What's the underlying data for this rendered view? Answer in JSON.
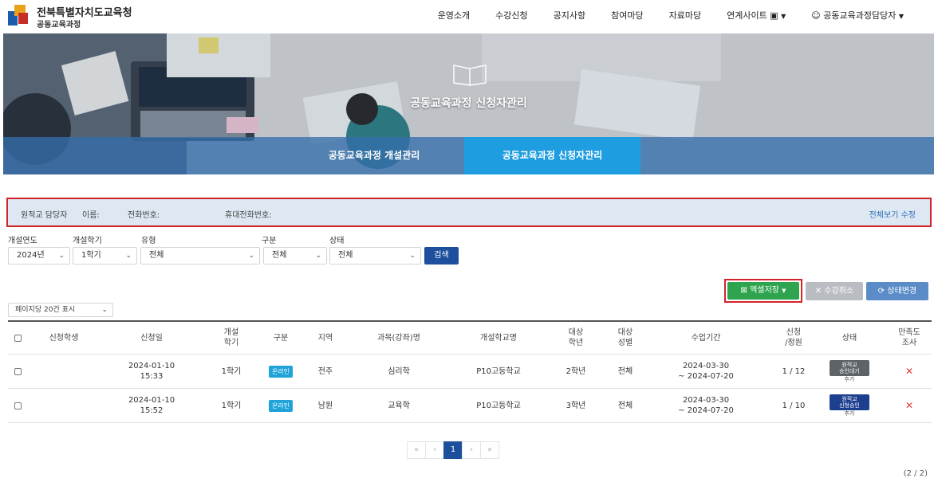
{
  "header": {
    "org_title": "전북특별자치도교육청",
    "org_subtitle": "공동교육과정",
    "nav": [
      "운영소개",
      "수강신청",
      "공지사항",
      "참여마당",
      "자료마당",
      "연계사이트"
    ],
    "user_label": "공동교육과정담당자"
  },
  "hero": {
    "title": "공동교육과정 신청자관리",
    "tabs": [
      "공동교육과정 개설관리",
      "공동교육과정 신청자관리"
    ]
  },
  "info_bar": {
    "school_manager_label": "원적교 담당자",
    "name_label": "이름:",
    "phone_label": "전화번호:",
    "mobile_label": "휴대전화번호:",
    "edit_link": "전체보기 수정"
  },
  "filters": {
    "year": {
      "label": "개설연도",
      "value": "2024년"
    },
    "semester": {
      "label": "개설학기",
      "value": "1학기"
    },
    "type": {
      "label": "유형",
      "value": "전체"
    },
    "category": {
      "label": "구분",
      "value": "전체"
    },
    "status": {
      "label": "상태",
      "value": "전체"
    },
    "search_label": "검색"
  },
  "actions": {
    "excel_label": "엑셀저장",
    "cancel_label": "수강취소",
    "status_change_label": "상태변경"
  },
  "page_size": "페이지당 20건 표시",
  "table": {
    "headers": {
      "student": "신청학생",
      "apply_date": "신청일",
      "semester": "개설\n학기",
      "category": "구분",
      "region": "지역",
      "subject": "과목(강좌)명",
      "school": "개설학교명",
      "target_grade": "대상\n학년",
      "target_gender": "대상\n성별",
      "period": "수업기간",
      "applicants": "신청\n/정원",
      "status": "상태",
      "survey": "만족도\n조사"
    },
    "rows": [
      {
        "student": "",
        "apply_date": "2024-01-10",
        "apply_time": "15:33",
        "semester": "1학기",
        "category": "온라인",
        "region": "전주",
        "subject": "심리학",
        "school": "P10고등학교",
        "target_grade": "2학년",
        "target_gender": "전체",
        "period_start": "2024-03-30",
        "period_end": "~ 2024-07-20",
        "applicants": "1 / 12",
        "status_line1": "원적교",
        "status_line2": "승인대기",
        "status_sub": "추가",
        "survey": "✕"
      },
      {
        "student": "",
        "apply_date": "2024-01-10",
        "apply_time": "15:52",
        "semester": "1학기",
        "category": "온라인",
        "region": "남원",
        "subject": "교육학",
        "school": "P10고등학교",
        "target_grade": "3학년",
        "target_gender": "전체",
        "period_start": "2024-03-30",
        "period_end": "~ 2024-07-20",
        "applicants": "1 / 10",
        "status_line1": "원적교",
        "status_line2": "신청승인",
        "status_sub": "추가",
        "survey": "✕"
      }
    ]
  },
  "pagination": {
    "first": "«",
    "prev": "‹",
    "current": "1",
    "next": "›",
    "last": "»",
    "count": "(2 / 2)"
  }
}
